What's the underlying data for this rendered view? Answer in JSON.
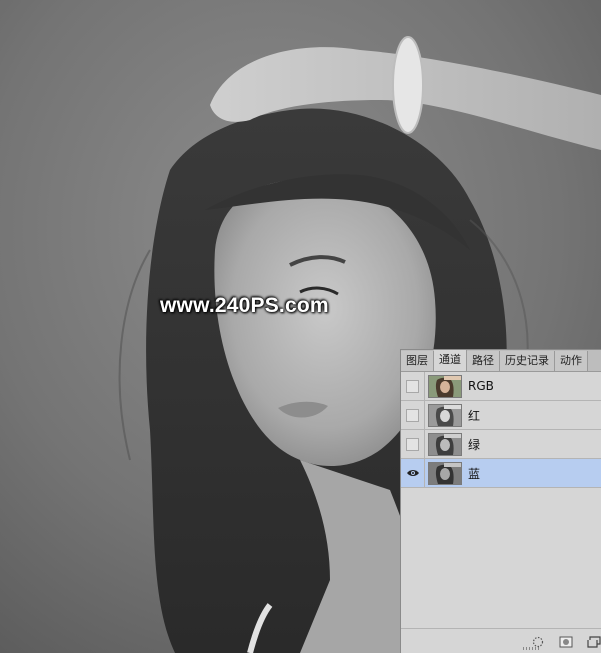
{
  "watermark": "www.240PS.com",
  "panel": {
    "tabs": [
      {
        "label": "图层",
        "active": false
      },
      {
        "label": "通道",
        "active": true
      },
      {
        "label": "路径",
        "active": false
      },
      {
        "label": "历史记录",
        "active": false
      },
      {
        "label": "动作",
        "active": false
      }
    ],
    "channels": [
      {
        "name": "RGB",
        "visible": false,
        "selected": false,
        "thumb": "color"
      },
      {
        "name": "红",
        "visible": false,
        "selected": false,
        "thumb": "gray"
      },
      {
        "name": "绿",
        "visible": false,
        "selected": false,
        "thumb": "gray"
      },
      {
        "name": "蓝",
        "visible": true,
        "selected": true,
        "thumb": "gray"
      }
    ],
    "footer_icons": [
      "load-selection-icon",
      "save-selection-icon",
      "new-channel-icon"
    ]
  },
  "colors": {
    "panel_bg": "#d6d6d6",
    "selected_row": "#b7cdf0",
    "tab_bar": "#bdbdbd"
  }
}
